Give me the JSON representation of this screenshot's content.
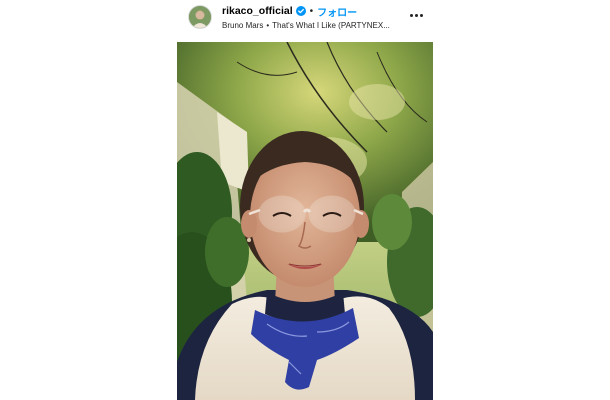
{
  "post": {
    "username": "rikaco_official",
    "follow_label": "フォロー",
    "separator": "•",
    "audio_artist": "Bruno Mars",
    "audio_sep": "•",
    "audio_title": "That's What I Like (PARTYNEX...",
    "more_icon": "more-options-icon",
    "verified_icon": "verified-badge-icon",
    "verified_color": "#0095f6"
  }
}
